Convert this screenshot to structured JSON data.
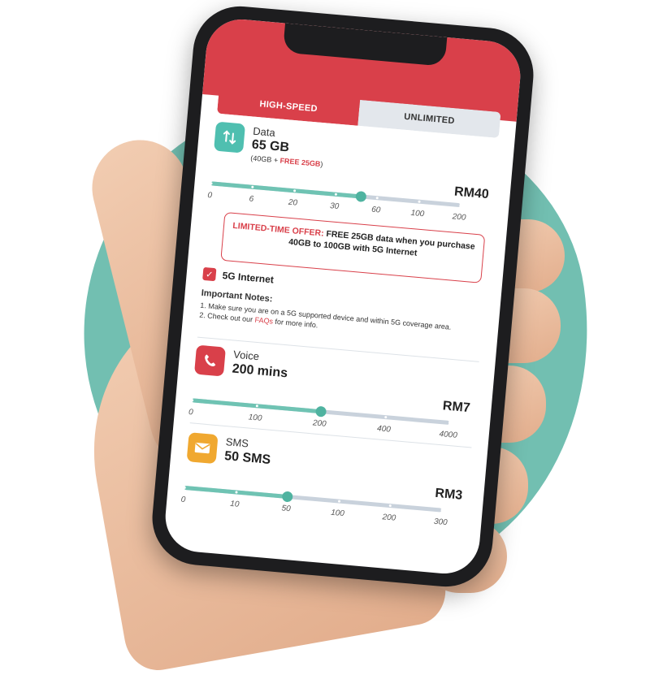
{
  "tabs": {
    "active": "HIGH-SPEED",
    "inactive": "UNLIMITED"
  },
  "data_plan": {
    "title": "Data",
    "amount": "65 GB",
    "breakdown_prefix": "(40GB + ",
    "breakdown_free": "FREE 25GB",
    "breakdown_suffix": ")",
    "price": "RM40",
    "ticks": [
      "0",
      "6",
      "20",
      "30",
      "60",
      "100",
      "200"
    ],
    "selected_fraction": 0.6
  },
  "offer": {
    "highlight": "LIMITED-TIME OFFER:",
    "text": "FREE 25GB data when you purchase 40GB to 100GB with 5G Internet"
  },
  "internet_5g": {
    "label": "5G Internet",
    "checked": true
  },
  "notes": {
    "title": "Important Notes:",
    "item1": "1. Make sure you are on a 5G supported device and within 5G coverage area.",
    "item2_prefix": "2. Check out our ",
    "item2_link": "FAQs",
    "item2_suffix": " for more info."
  },
  "voice_plan": {
    "title": "Voice",
    "amount": "200 mins",
    "price": "RM7",
    "ticks": [
      "0",
      "100",
      "200",
      "400",
      "4000"
    ],
    "selected_fraction": 0.5
  },
  "sms_plan": {
    "title": "SMS",
    "amount": "50 SMS",
    "price": "RM3",
    "ticks": [
      "0",
      "10",
      "50",
      "100",
      "200",
      "300"
    ],
    "selected_fraction": 0.4
  },
  "colors": {
    "brand": "#d9404a",
    "accent": "#6fc3b3",
    "data_icon": "#4fbfb0",
    "voice_icon": "#d9404a",
    "sms_icon": "#f0a830"
  },
  "icons": {
    "data": "data-transfer-icon",
    "voice": "phone-icon",
    "sms": "envelope-icon"
  }
}
